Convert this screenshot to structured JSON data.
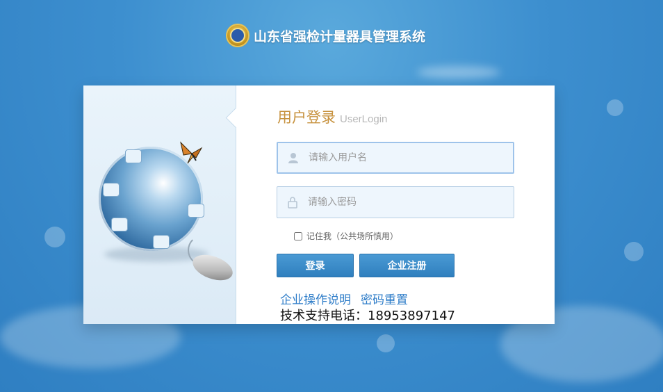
{
  "header": {
    "title": "山东省强检计量器具管理系统"
  },
  "login": {
    "title_zh": "用户登录",
    "title_en": "UserLogin",
    "username_placeholder": "请输入用户名",
    "password_placeholder": "请输入密码",
    "remember_label": "记住我（公共场所慎用）",
    "login_button": "登录",
    "register_button": "企业注册"
  },
  "links": {
    "manual": "企业操作说明",
    "reset_password": "密码重置"
  },
  "support": {
    "text": "技术支持电话：18953897147"
  },
  "colors": {
    "accent": "#2f7fbe",
    "title_gold": "#c7923e",
    "link": "#2d7cc8"
  }
}
